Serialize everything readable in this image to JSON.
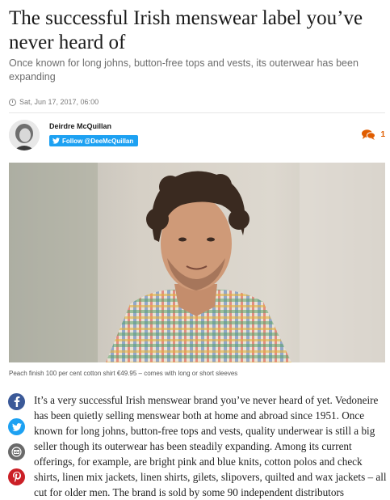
{
  "article": {
    "headline": "The successful Irish menswear label you’ve never heard of",
    "standfirst": "Once known for long johns, button-free tops and vests, its outerwear has been expanding",
    "date": "Sat, Jun 17, 2017, 06:00"
  },
  "author": {
    "name": "Deirdre McQuillan",
    "follow_label": "Follow @DeeMcQuillan"
  },
  "comments": {
    "count": "1"
  },
  "image": {
    "caption": "Peach finish 100 per cent cotton shirt €49.95 – comes with long or short sleeves"
  },
  "share": {
    "facebook_icon": "facebook-icon",
    "twitter_icon": "twitter-icon",
    "email_icon": "email-icon",
    "pinterest_icon": "pinterest-icon"
  },
  "body": {
    "paragraph_1": "It’s a very successful Irish menswear brand you’ve never heard of yet. Vedoneire has been quietly selling menswear both at home and abroad since 1951. Once known for long johns, button-free tops and vests, quality underwear is still a big seller though its outerwear has been steadily expanding. Among its current offerings, for example, are bright pink and blue knits, cotton polos and check shirts, linen mix jackets, linen shirts, gilets, slipovers, quilted and wax jackets – all cut for older men. The brand is sold by some 90 independent distributors"
  },
  "colors": {
    "twitter_blue": "#1da1f2",
    "comment_orange": "#e05d00",
    "facebook_blue": "#3b5998",
    "pinterest_red": "#cb2027"
  }
}
